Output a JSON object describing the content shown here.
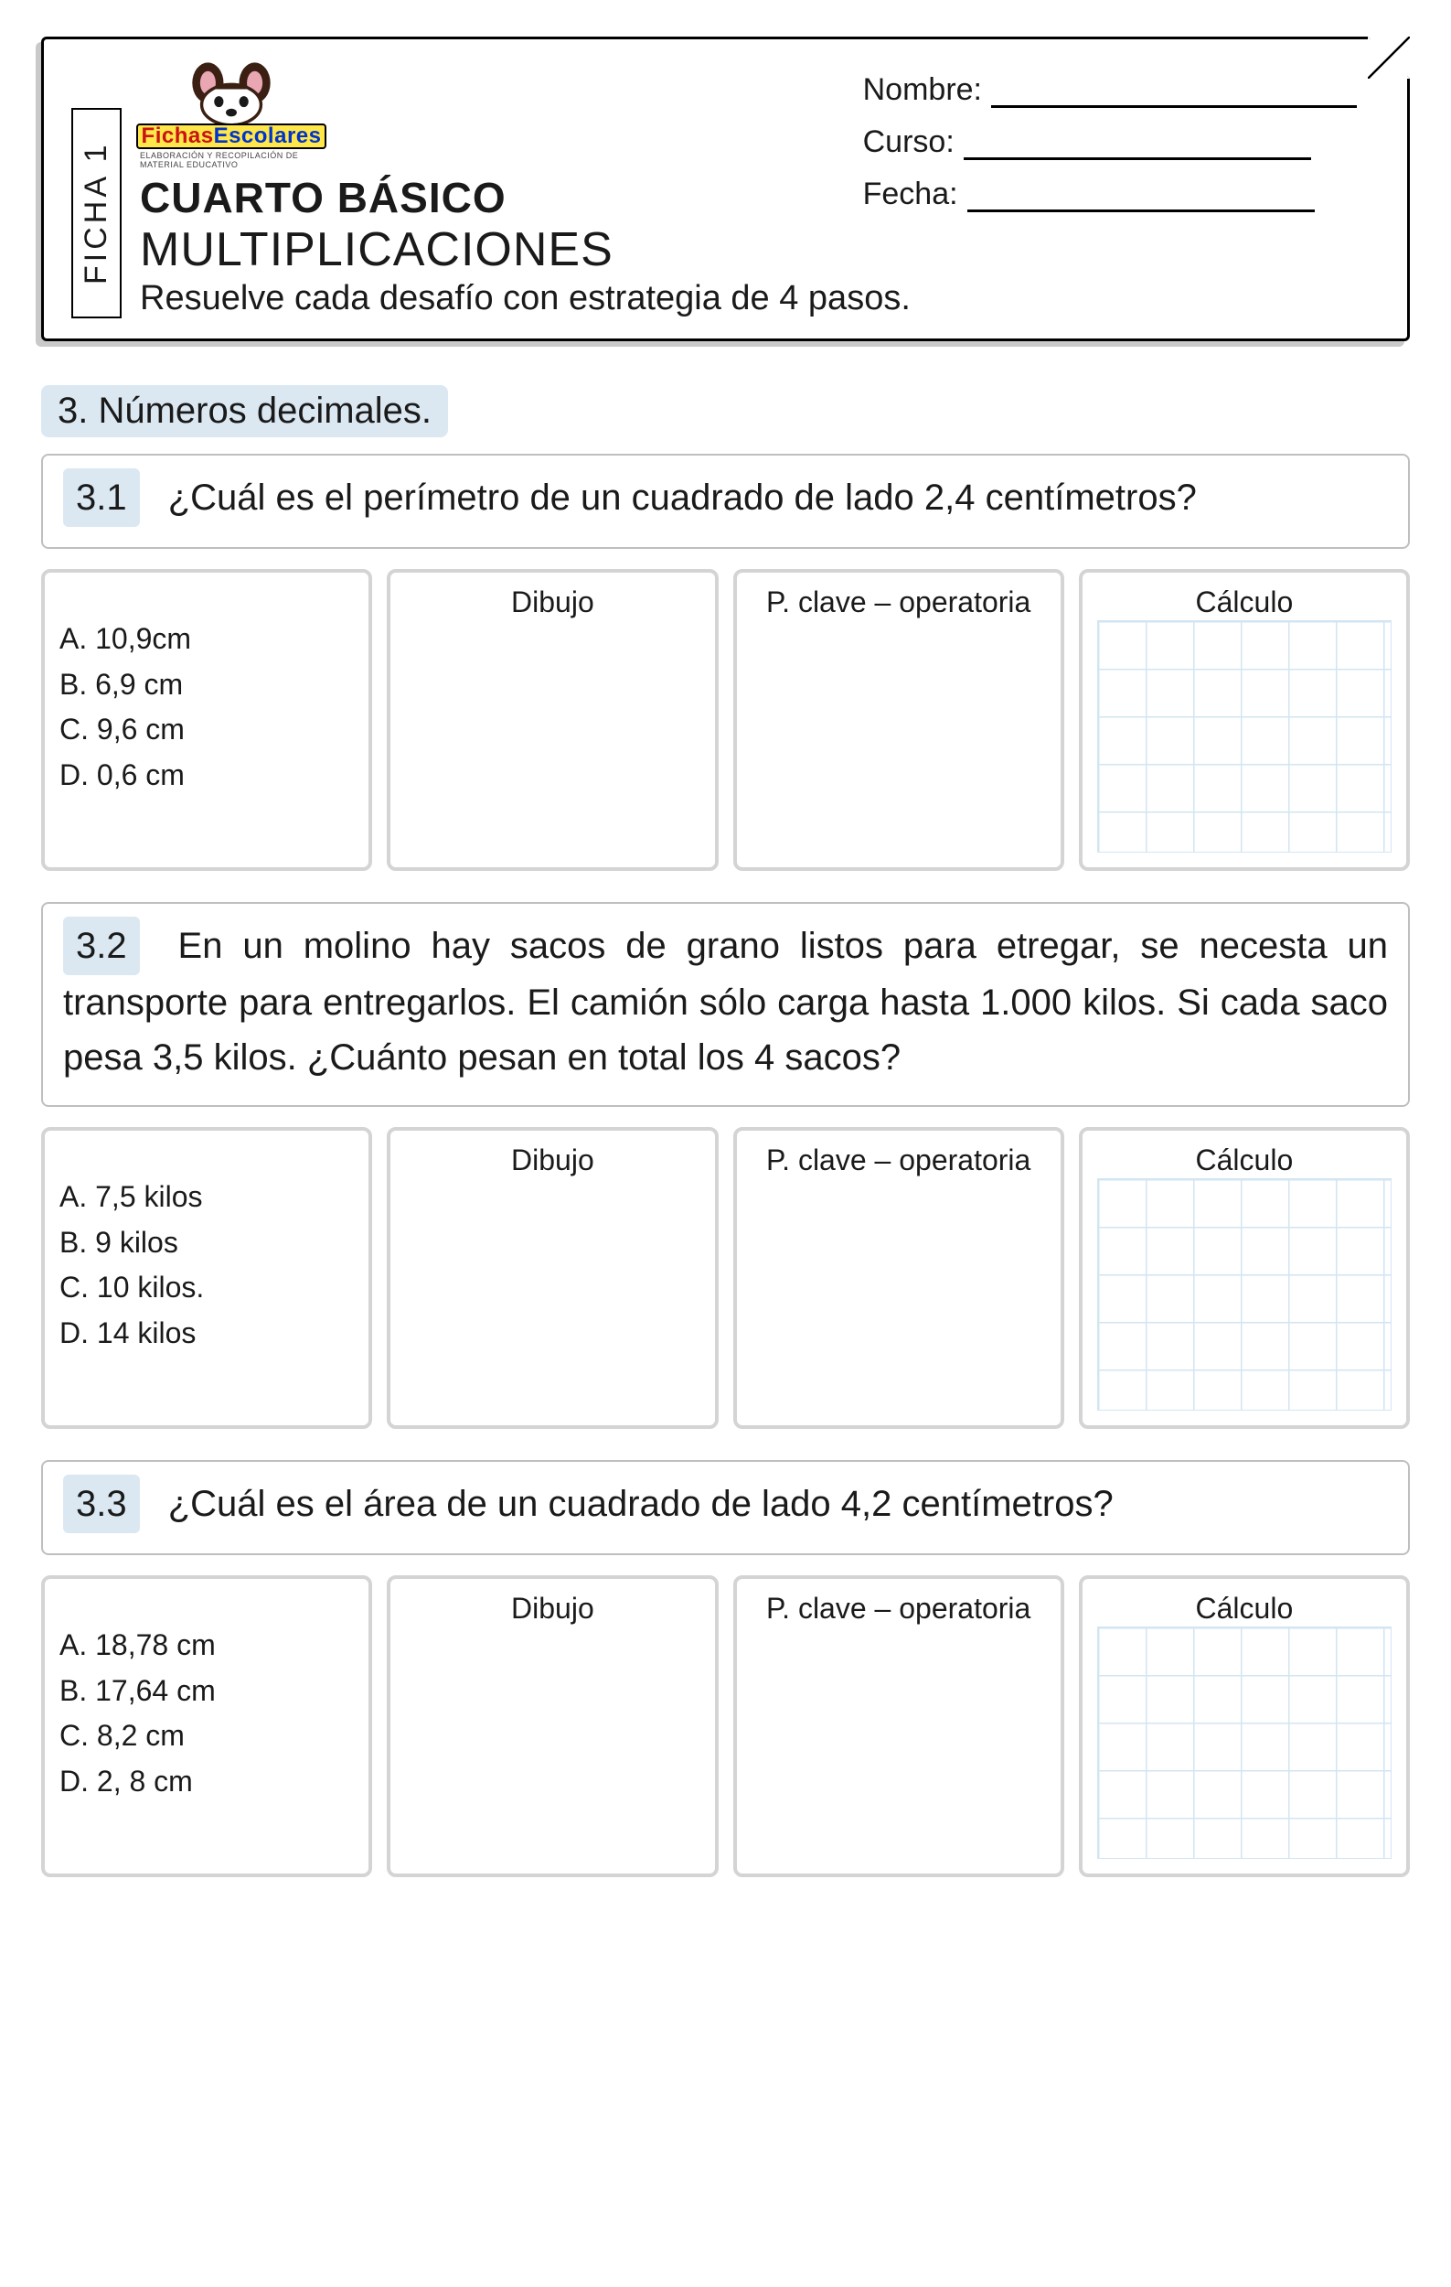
{
  "header": {
    "ficha_label": "FICHA 1",
    "logo_part1": "Fichas",
    "logo_part2": "Escolares",
    "logo_sub": "ELABORACIÓN Y RECOPILACIÓN DE MATERIAL EDUCATIVO",
    "grade": "CUARTO BÁSICO",
    "topic": "MULTIPLICACIONES",
    "instruction": "Resuelve cada desafío con estrategia de 4 pasos.",
    "field_nombre": "Nombre:",
    "field_curso": "Curso:",
    "field_fecha": "Fecha:"
  },
  "section": {
    "title": "3. Números decimales."
  },
  "col_titles": {
    "dibujo": "Dibujo",
    "clave": "P. clave – operatoria",
    "calculo": "Cálculo"
  },
  "problems": [
    {
      "num": "3.1",
      "text": "¿Cuál es el perímetro de un cuadrado de lado 2,4 centímetros?",
      "options": [
        "A. 10,9cm",
        "B. 6,9 cm",
        "C. 9,6 cm",
        "D. 0,6 cm"
      ]
    },
    {
      "num": "3.2",
      "text": "En un molino hay sacos de grano listos para etregar, se necesta un transporte para entregarlos. El camión sólo carga hasta 1.000 kilos. Si cada saco pesa 3,5 kilos. ¿Cuánto pesan en total los 4 sacos?",
      "options": [
        "A. 7,5 kilos",
        "B. 9 kilos",
        "C. 10 kilos.",
        "D. 14 kilos"
      ]
    },
    {
      "num": "3.3",
      "text": "¿Cuál es el área de un cuadrado de lado 4,2 centímetros?",
      "options": [
        "A. 18,78 cm",
        "B. 17,64 cm",
        "C. 8,2 cm",
        "D. 2, 8 cm"
      ]
    }
  ]
}
